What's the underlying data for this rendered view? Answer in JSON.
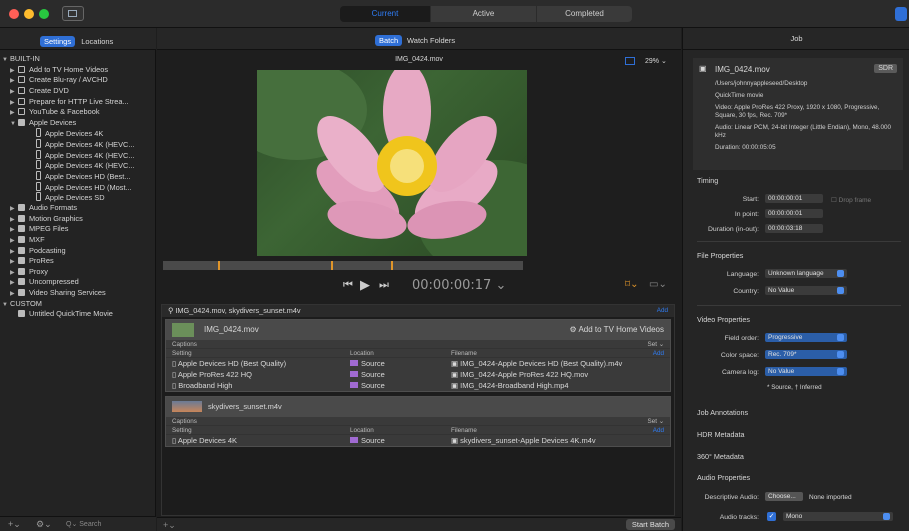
{
  "window": {
    "tabs": [
      "Current",
      "Active",
      "Completed"
    ],
    "active_tab": 0
  },
  "sidebar": {
    "tabs": [
      "Settings",
      "Locations"
    ],
    "search_placeholder": "Search",
    "items": [
      {
        "label": "BUILT-IN",
        "level": 0,
        "type": "group"
      },
      {
        "label": "Add to TV Home Videos",
        "level": 1,
        "icon": "share"
      },
      {
        "label": "Create Blu-ray / AVCHD",
        "level": 1,
        "icon": "share"
      },
      {
        "label": "Create DVD",
        "level": 1,
        "icon": "share"
      },
      {
        "label": "Prepare for HTTP Live Strea...",
        "level": 1,
        "icon": "share"
      },
      {
        "label": "YouTube & Facebook",
        "level": 1,
        "icon": "share"
      },
      {
        "label": "Apple Devices",
        "level": 1,
        "icon": "stack",
        "open": true
      },
      {
        "label": "Apple Devices 4K",
        "level": 2,
        "icon": "device"
      },
      {
        "label": "Apple Devices 4K (HEVC...",
        "level": 2,
        "icon": "device"
      },
      {
        "label": "Apple Devices 4K (HEVC...",
        "level": 2,
        "icon": "device"
      },
      {
        "label": "Apple Devices 4K (HEVC...",
        "level": 2,
        "icon": "device"
      },
      {
        "label": "Apple Devices HD (Best...",
        "level": 2,
        "icon": "device"
      },
      {
        "label": "Apple Devices HD (Most...",
        "level": 2,
        "icon": "device"
      },
      {
        "label": "Apple Devices SD",
        "level": 2,
        "icon": "device"
      },
      {
        "label": "Audio Formats",
        "level": 1,
        "icon": "stack"
      },
      {
        "label": "Motion Graphics",
        "level": 1,
        "icon": "stack"
      },
      {
        "label": "MPEG Files",
        "level": 1,
        "icon": "stack"
      },
      {
        "label": "MXF",
        "level": 1,
        "icon": "stack"
      },
      {
        "label": "Podcasting",
        "level": 1,
        "icon": "stack"
      },
      {
        "label": "ProRes",
        "level": 1,
        "icon": "stack"
      },
      {
        "label": "Proxy",
        "level": 1,
        "icon": "stack"
      },
      {
        "label": "Uncompressed",
        "level": 1,
        "icon": "stack"
      },
      {
        "label": "Video Sharing Services",
        "level": 1,
        "icon": "stack"
      },
      {
        "label": "CUSTOM",
        "level": 0,
        "type": "group"
      },
      {
        "label": "Untitled QuickTime Movie",
        "level": 1,
        "icon": "qt"
      }
    ]
  },
  "center": {
    "tabs": [
      "Batch",
      "Watch Folders"
    ],
    "filename": "IMG_0424.mov",
    "zoom": "29%",
    "timecode": "00:00:00:17",
    "batch_title": "IMG_0424.mov, skydivers_sunset.m4v",
    "add_label": "Add",
    "start_label": "Start Batch",
    "job1": {
      "name": "IMG_0424.mov",
      "target": "Add to TV Home Videos",
      "captions": "Captions",
      "set": "Set",
      "cols": [
        "Setting",
        "Location",
        "Filename"
      ],
      "rows": [
        {
          "setting": "Apple Devices HD (Best Quality)",
          "location": "Source",
          "filename": "IMG_0424-Apple Devices HD (Best Quality).m4v"
        },
        {
          "setting": "Apple ProRes 422 HQ",
          "location": "Source",
          "filename": "IMG_0424-Apple ProRes 422 HQ.mov"
        },
        {
          "setting": "Broadband High",
          "location": "Source",
          "filename": "IMG_0424-Broadband High.mp4"
        }
      ]
    },
    "job2": {
      "name": "skydivers_sunset.m4v",
      "captions": "Captions",
      "set": "Set",
      "cols": [
        "Setting",
        "Location",
        "Filename"
      ],
      "rows": [
        {
          "setting": "Apple Devices 4K",
          "location": "Source",
          "filename": "skydivers_sunset-Apple Devices 4K.m4v"
        }
      ]
    }
  },
  "inspector": {
    "title": "Job",
    "filename": "IMG_0424.mov",
    "badge": "SDR",
    "path": "/Users/johnnyappleseed/Desktop",
    "type": "QuickTime movie",
    "video": "Video: Apple ProRes 422 Proxy, 1920 x 1080, Progressive, Square, 30 fps, Rec. 709*",
    "audio": "Audio: Linear PCM, 24-bit Integer (Little Endian), Mono, 48.000 kHz",
    "duration": "Duration: 00:00:05:05",
    "timing": {
      "title": "Timing",
      "start_label": "Start:",
      "start": "00:00:00:01",
      "drop": "Drop frame",
      "in_label": "In point:",
      "in": "00:00:00:01",
      "dur_label": "Duration (in-out):",
      "dur": "00:00:03:18"
    },
    "file": {
      "title": "File Properties",
      "lang_label": "Language:",
      "lang": "Unknown language",
      "country_label": "Country:",
      "country": "No Value"
    },
    "videoprops": {
      "title": "Video Properties",
      "field_label": "Field order:",
      "field": "Progressive",
      "color_label": "Color space:",
      "color": "Rec. 709*",
      "log_label": "Camera log:",
      "log": "No Value",
      "note": "* Source, † Inferred"
    },
    "sections": [
      "Job Annotations",
      "HDR Metadata",
      "360° Metadata",
      "Audio Properties"
    ],
    "audioprops": {
      "desc_label": "Descriptive Audio:",
      "choose": "Choose...",
      "none": "None imported",
      "tracks_label": "Audio tracks:",
      "track": "Mono"
    }
  }
}
